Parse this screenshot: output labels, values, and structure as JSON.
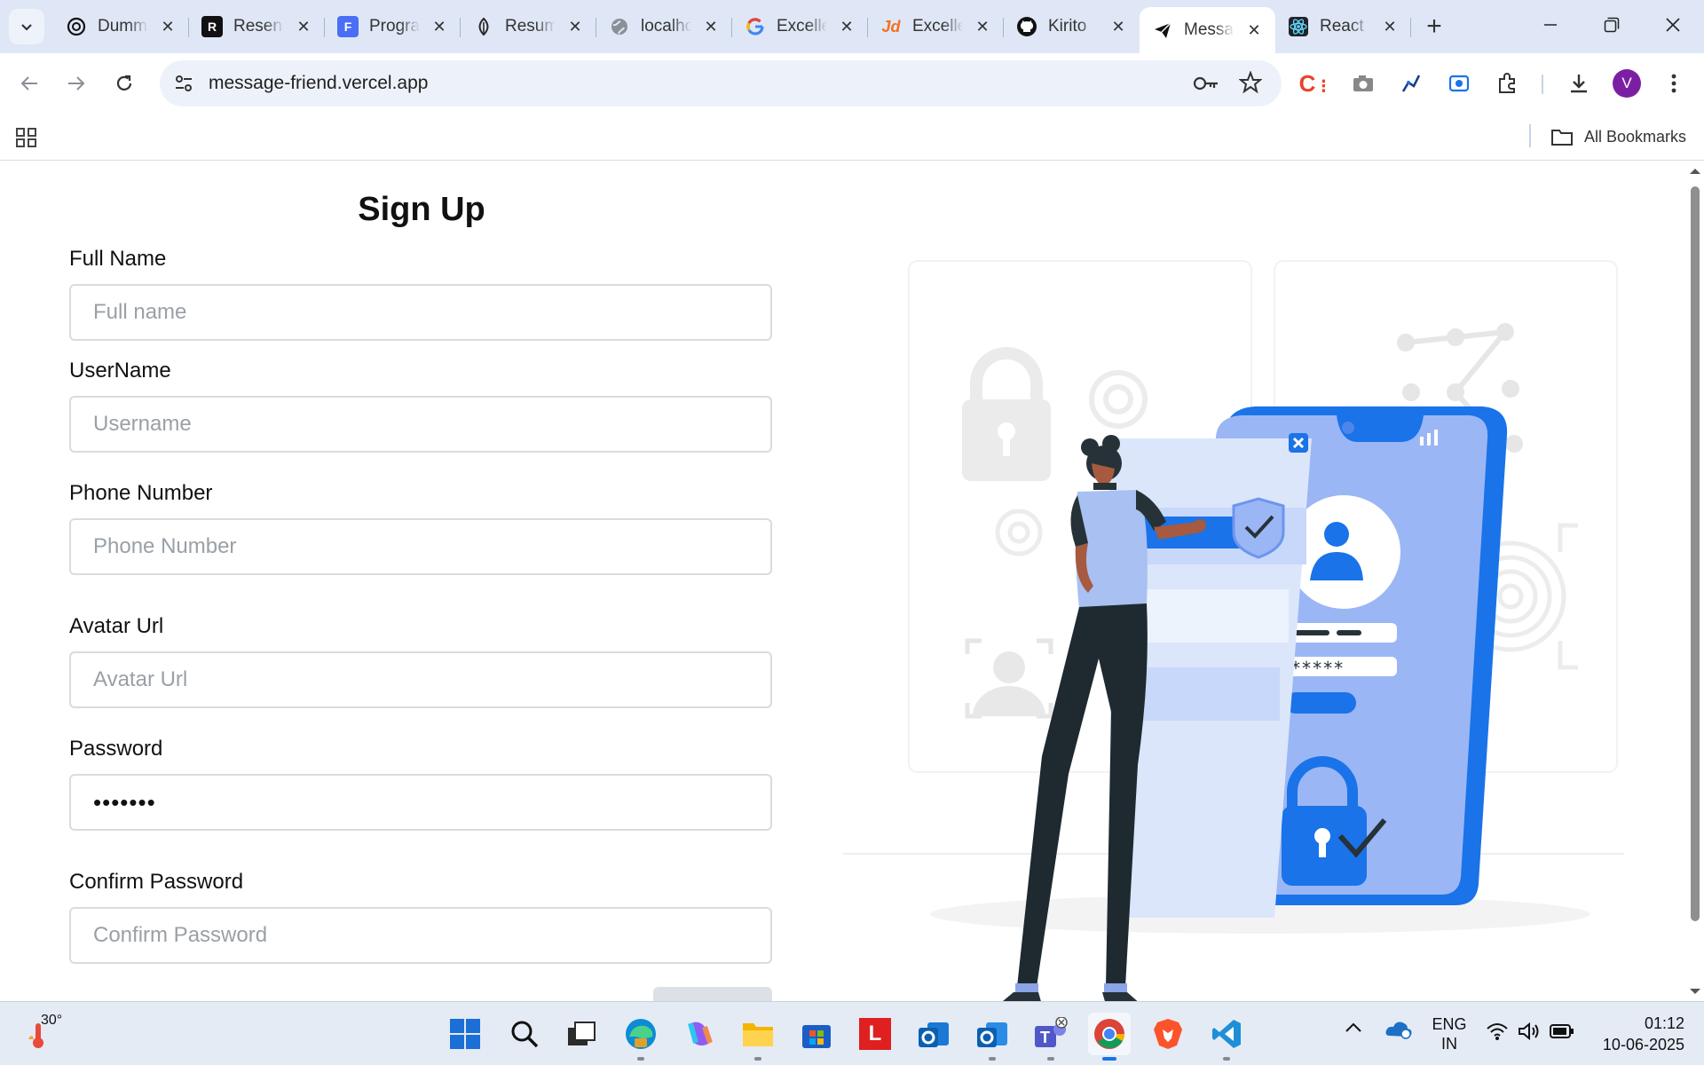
{
  "browser": {
    "tabs": [
      {
        "label": "Dummy",
        "icon": "openai-icon"
      },
      {
        "label": "Resend",
        "icon": "resend-icon"
      },
      {
        "label": "Programs",
        "icon": "forms-icon"
      },
      {
        "label": "Resume",
        "icon": "leaf-icon"
      },
      {
        "label": "localhost",
        "icon": "globe-icon"
      },
      {
        "label": "Excellent",
        "icon": "google-icon"
      },
      {
        "label": "Excellent",
        "icon": "jd-icon"
      },
      {
        "label": "Kirito",
        "icon": "github-icon"
      },
      {
        "label": "Message",
        "icon": "paper-plane-icon",
        "active": true
      },
      {
        "label": "React",
        "icon": "react-icon"
      }
    ],
    "url": "message-friend.vercel.app",
    "bookmarks_label": "All Bookmarks",
    "profile_initial": "V"
  },
  "form": {
    "title": "Sign Up",
    "fields": [
      {
        "label": "Full Name",
        "placeholder": "Full name",
        "value": ""
      },
      {
        "label": "UserName",
        "placeholder": "Username",
        "value": ""
      },
      {
        "label": "Phone Number",
        "placeholder": "Phone Number",
        "value": ""
      },
      {
        "label": "Avatar Url",
        "placeholder": "Avatar Url",
        "value": ""
      },
      {
        "label": "Password",
        "placeholder": "Password",
        "value": "•••••••"
      },
      {
        "label": "Confirm Password",
        "placeholder": "Confirm Password",
        "value": ""
      }
    ]
  },
  "illustration": {
    "password_mask": "*****"
  },
  "taskbar": {
    "weather_temp": "30°",
    "language": "ENG",
    "region": "IN",
    "time": "01:12",
    "date": "10-06-2025"
  },
  "colors": {
    "accent_blue": "#1a73e8",
    "phone_blue": "#407bff",
    "tab_strip": "#dfe7f6"
  }
}
